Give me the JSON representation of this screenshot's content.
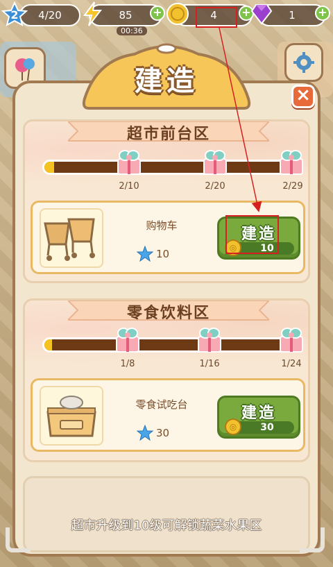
{
  "hud": {
    "level": "2",
    "stars": "4/20",
    "energy": "85",
    "energy_timer": "00:36",
    "coins": "4",
    "gems": "1",
    "add_symbol": "+"
  },
  "dialog": {
    "title": "建造",
    "close_symbol": "×"
  },
  "sections": [
    {
      "name": "超市前台区",
      "milestones": [
        "2/10",
        "2/20",
        "2/29"
      ],
      "progress_fraction": 0.04,
      "item": {
        "name": "购物车",
        "stars": "10",
        "build_label": "建造",
        "cost": "10"
      }
    },
    {
      "name": "零食饮料区",
      "milestones": [
        "1/8",
        "1/16",
        "1/24"
      ],
      "progress_fraction": 0.03,
      "item": {
        "name": "零食试吃台",
        "stars": "30",
        "build_label": "建造",
        "cost": "30"
      }
    }
  ],
  "locked": {
    "message": "超市升级到10级可解锁蔬菜水果区"
  },
  "colors": {
    "accent_green": "#7aaa3d",
    "panel_border": "#a27a52",
    "annotation_red": "#d62020"
  }
}
